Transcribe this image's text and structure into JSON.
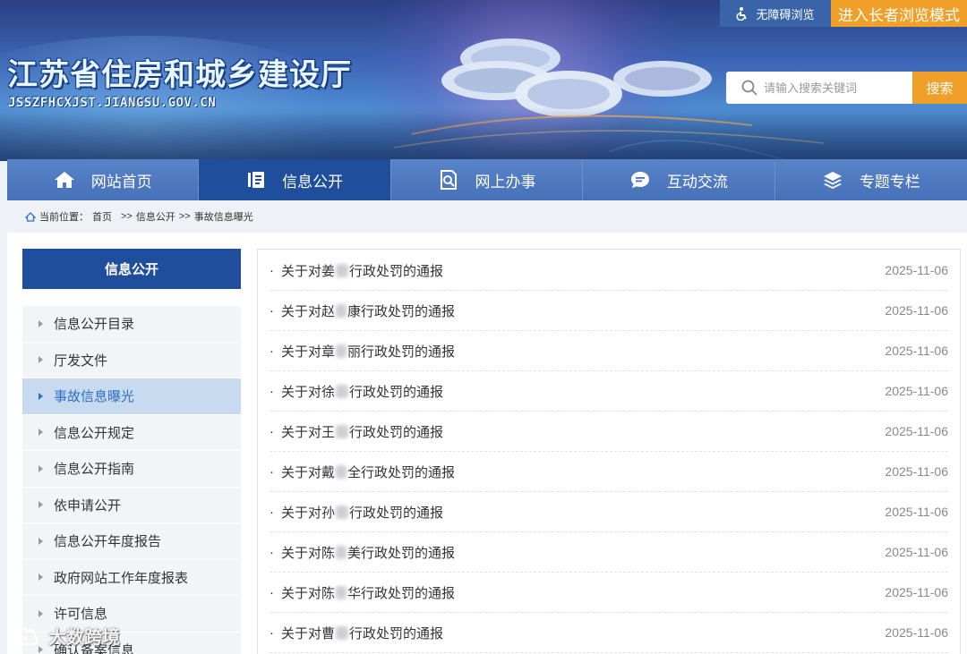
{
  "site": {
    "name": "江苏省住房和城乡建设厅",
    "domain": "JSSZFHCXJST.JIANGSU.GOV.CN"
  },
  "topbar": {
    "accessibility_label": "无障碍浏览",
    "elder_mode_label": "进入长者浏览模式"
  },
  "search": {
    "placeholder": "请输入搜索关键词",
    "button_label": "搜索"
  },
  "nav": {
    "items": [
      {
        "label": "网站首页",
        "icon": "home-icon"
      },
      {
        "label": "信息公开",
        "icon": "document-icon"
      },
      {
        "label": "网上办事",
        "icon": "search-doc-icon"
      },
      {
        "label": "互动交流",
        "icon": "chat-icon"
      },
      {
        "label": "专题专栏",
        "icon": "layers-icon"
      }
    ],
    "active_index": 1
  },
  "breadcrumb": {
    "prefix": "当前位置：",
    "home": "首页",
    "sep1": ">>",
    "level1": "信息公开",
    "sep2": ">>",
    "level2": "事故信息曝光"
  },
  "sidebar": {
    "title": "信息公开",
    "items": [
      {
        "label": "信息公开目录"
      },
      {
        "label": "厅发文件"
      },
      {
        "label": "事故信息曝光"
      },
      {
        "label": "信息公开规定"
      },
      {
        "label": "信息公开指南"
      },
      {
        "label": "依申请公开"
      },
      {
        "label": "信息公开年度报告"
      },
      {
        "label": "政府网站工作年度报表"
      },
      {
        "label": "许可信息"
      },
      {
        "label": "确认备案信息"
      }
    ],
    "active_index": 2
  },
  "news": {
    "bullet": "·",
    "items": [
      {
        "pre": "关于对姜",
        "post": "行政处罚的通报",
        "date": "2025-11-06"
      },
      {
        "pre": "关于对赵",
        "post": "康行政处罚的通报",
        "date": "2025-11-06"
      },
      {
        "pre": "关于对章",
        "post": "丽行政处罚的通报",
        "date": "2025-11-06"
      },
      {
        "pre": "关于对徐",
        "post": "行政处罚的通报",
        "date": "2025-11-06"
      },
      {
        "pre": "关于对王",
        "post": "行政处罚的通报",
        "date": "2025-11-06"
      },
      {
        "pre": "关于对戴",
        "post": "全行政处罚的通报",
        "date": "2025-11-06"
      },
      {
        "pre": "关于对孙",
        "post": "行政处罚的通报",
        "date": "2025-11-06"
      },
      {
        "pre": "关于对陈",
        "post": "美行政处罚的通报",
        "date": "2025-11-06"
      },
      {
        "pre": "关于对陈",
        "post": "华行政处罚的通报",
        "date": "2025-11-06"
      },
      {
        "pre": "关于对曹",
        "post": "行政处罚的通报",
        "date": "2025-11-06"
      }
    ]
  },
  "watermark": "大数跨境",
  "colors": {
    "nav_active": "#1f4f9c",
    "nav_bg": "#4670b8",
    "accent_orange": "#f0a028",
    "sidebar_active_bg": "#c8daf0",
    "sidebar_active_text": "#2d6fc4"
  }
}
